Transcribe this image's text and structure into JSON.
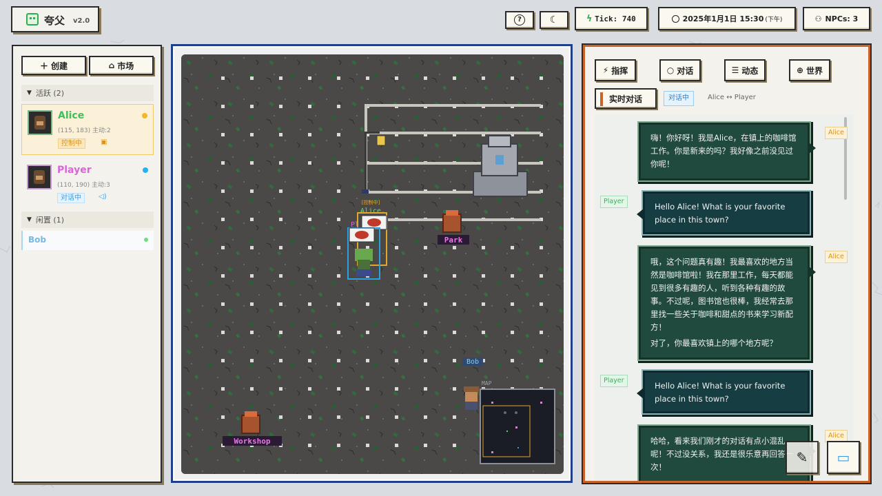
{
  "app": {
    "title": "夸父",
    "version": "v2.0"
  },
  "topbar": {
    "help_icon": "?",
    "theme_icon": "☾",
    "tick_label": "Tick: 740",
    "date": "2025年1月1日 15:30",
    "date_suffix": "(下午)",
    "npc_count": "NPCs: 3"
  },
  "sidebar": {
    "create_label": "创建",
    "market_label": "市场",
    "active_heading": "活跃 (2)",
    "idle_heading": "闲置 (1)",
    "npcs": [
      {
        "name": "Alice",
        "meta": "(115, 183)  主动:2",
        "tag": "控制中",
        "dot_color": "#f5b627"
      },
      {
        "name": "Player",
        "meta": "(110, 190)  主动:3",
        "tag": "对话中",
        "dot_color": "#29b0f0"
      }
    ],
    "idle": [
      {
        "name": "Bob",
        "dot_color": "#6ddc86"
      }
    ]
  },
  "map": {
    "labels": {
      "alice_status": "[控制中]",
      "alice": "Alice",
      "player_abbr": "Pl",
      "park": "Park",
      "workshop": "Workshop",
      "bob": "Bob",
      "minimap": "MAP"
    }
  },
  "chat": {
    "tabs": [
      {
        "label": "指挥",
        "icon": "⚡"
      },
      {
        "label": "对话",
        "icon": "○"
      },
      {
        "label": "动态",
        "icon": "☰"
      },
      {
        "label": "世界",
        "icon": "⊕"
      }
    ],
    "subtab": "实时对话",
    "tag": "对话中",
    "pair": "Alice ↔ Player",
    "messages": [
      {
        "speaker": "Alice",
        "text": "嗨！你好呀！我是Alice，在镇上的咖啡馆工作。你是新来的吗？我好像之前没见过你呢！"
      },
      {
        "speaker": "Player",
        "text": "Hello Alice! What is your favorite place in this town?"
      },
      {
        "speaker": "Alice",
        "text": "哦，这个问题真有趣！我最喜欢的地方当然是咖啡馆啦！我在那里工作，每天都能见到很多有趣的人，听到各种有趣的故事。不过呢，图书馆也很棒，我经常去那里找一些关于咖啡和甜点的书来学习新配方！",
        "text2": "对了，你最喜欢镇上的哪个地方呢？"
      },
      {
        "speaker": "Player",
        "text": "Hello Alice! What is your favorite place in this town?"
      },
      {
        "speaker": "Alice",
        "text": "哈哈，看来我们刚才的对话有点小混乱呢！不过没关系，我还是很乐意再回答一次！"
      }
    ]
  },
  "colors": {
    "accent_green": "#3fbf5a",
    "accent_orange": "#c8642a",
    "map_border": "#1f3f8a",
    "bubble_bg": "#1f4a3d"
  }
}
